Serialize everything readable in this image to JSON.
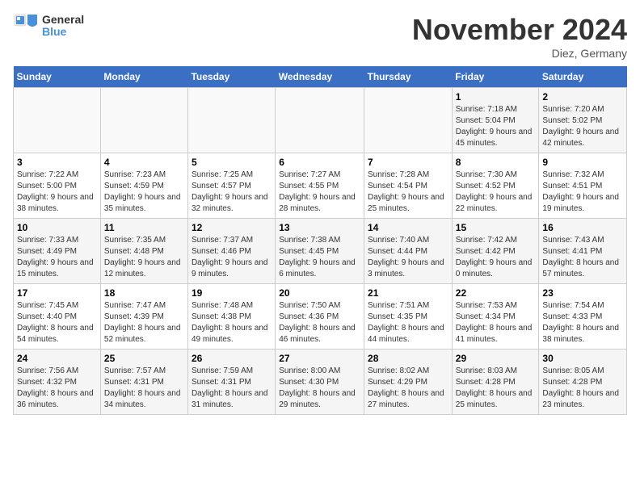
{
  "logo": {
    "text_general": "General",
    "text_blue": "Blue"
  },
  "title": "November 2024",
  "subtitle": "Diez, Germany",
  "days_of_week": [
    "Sunday",
    "Monday",
    "Tuesday",
    "Wednesday",
    "Thursday",
    "Friday",
    "Saturday"
  ],
  "weeks": [
    [
      {
        "day": "",
        "info": ""
      },
      {
        "day": "",
        "info": ""
      },
      {
        "day": "",
        "info": ""
      },
      {
        "day": "",
        "info": ""
      },
      {
        "day": "",
        "info": ""
      },
      {
        "day": "1",
        "info": "Sunrise: 7:18 AM\nSunset: 5:04 PM\nDaylight: 9 hours and 45 minutes."
      },
      {
        "day": "2",
        "info": "Sunrise: 7:20 AM\nSunset: 5:02 PM\nDaylight: 9 hours and 42 minutes."
      }
    ],
    [
      {
        "day": "3",
        "info": "Sunrise: 7:22 AM\nSunset: 5:00 PM\nDaylight: 9 hours and 38 minutes."
      },
      {
        "day": "4",
        "info": "Sunrise: 7:23 AM\nSunset: 4:59 PM\nDaylight: 9 hours and 35 minutes."
      },
      {
        "day": "5",
        "info": "Sunrise: 7:25 AM\nSunset: 4:57 PM\nDaylight: 9 hours and 32 minutes."
      },
      {
        "day": "6",
        "info": "Sunrise: 7:27 AM\nSunset: 4:55 PM\nDaylight: 9 hours and 28 minutes."
      },
      {
        "day": "7",
        "info": "Sunrise: 7:28 AM\nSunset: 4:54 PM\nDaylight: 9 hours and 25 minutes."
      },
      {
        "day": "8",
        "info": "Sunrise: 7:30 AM\nSunset: 4:52 PM\nDaylight: 9 hours and 22 minutes."
      },
      {
        "day": "9",
        "info": "Sunrise: 7:32 AM\nSunset: 4:51 PM\nDaylight: 9 hours and 19 minutes."
      }
    ],
    [
      {
        "day": "10",
        "info": "Sunrise: 7:33 AM\nSunset: 4:49 PM\nDaylight: 9 hours and 15 minutes."
      },
      {
        "day": "11",
        "info": "Sunrise: 7:35 AM\nSunset: 4:48 PM\nDaylight: 9 hours and 12 minutes."
      },
      {
        "day": "12",
        "info": "Sunrise: 7:37 AM\nSunset: 4:46 PM\nDaylight: 9 hours and 9 minutes."
      },
      {
        "day": "13",
        "info": "Sunrise: 7:38 AM\nSunset: 4:45 PM\nDaylight: 9 hours and 6 minutes."
      },
      {
        "day": "14",
        "info": "Sunrise: 7:40 AM\nSunset: 4:44 PM\nDaylight: 9 hours and 3 minutes."
      },
      {
        "day": "15",
        "info": "Sunrise: 7:42 AM\nSunset: 4:42 PM\nDaylight: 9 hours and 0 minutes."
      },
      {
        "day": "16",
        "info": "Sunrise: 7:43 AM\nSunset: 4:41 PM\nDaylight: 8 hours and 57 minutes."
      }
    ],
    [
      {
        "day": "17",
        "info": "Sunrise: 7:45 AM\nSunset: 4:40 PM\nDaylight: 8 hours and 54 minutes."
      },
      {
        "day": "18",
        "info": "Sunrise: 7:47 AM\nSunset: 4:39 PM\nDaylight: 8 hours and 52 minutes."
      },
      {
        "day": "19",
        "info": "Sunrise: 7:48 AM\nSunset: 4:38 PM\nDaylight: 8 hours and 49 minutes."
      },
      {
        "day": "20",
        "info": "Sunrise: 7:50 AM\nSunset: 4:36 PM\nDaylight: 8 hours and 46 minutes."
      },
      {
        "day": "21",
        "info": "Sunrise: 7:51 AM\nSunset: 4:35 PM\nDaylight: 8 hours and 44 minutes."
      },
      {
        "day": "22",
        "info": "Sunrise: 7:53 AM\nSunset: 4:34 PM\nDaylight: 8 hours and 41 minutes."
      },
      {
        "day": "23",
        "info": "Sunrise: 7:54 AM\nSunset: 4:33 PM\nDaylight: 8 hours and 38 minutes."
      }
    ],
    [
      {
        "day": "24",
        "info": "Sunrise: 7:56 AM\nSunset: 4:32 PM\nDaylight: 8 hours and 36 minutes."
      },
      {
        "day": "25",
        "info": "Sunrise: 7:57 AM\nSunset: 4:31 PM\nDaylight: 8 hours and 34 minutes."
      },
      {
        "day": "26",
        "info": "Sunrise: 7:59 AM\nSunset: 4:31 PM\nDaylight: 8 hours and 31 minutes."
      },
      {
        "day": "27",
        "info": "Sunrise: 8:00 AM\nSunset: 4:30 PM\nDaylight: 8 hours and 29 minutes."
      },
      {
        "day": "28",
        "info": "Sunrise: 8:02 AM\nSunset: 4:29 PM\nDaylight: 8 hours and 27 minutes."
      },
      {
        "day": "29",
        "info": "Sunrise: 8:03 AM\nSunset: 4:28 PM\nDaylight: 8 hours and 25 minutes."
      },
      {
        "day": "30",
        "info": "Sunrise: 8:05 AM\nSunset: 4:28 PM\nDaylight: 8 hours and 23 minutes."
      }
    ]
  ]
}
